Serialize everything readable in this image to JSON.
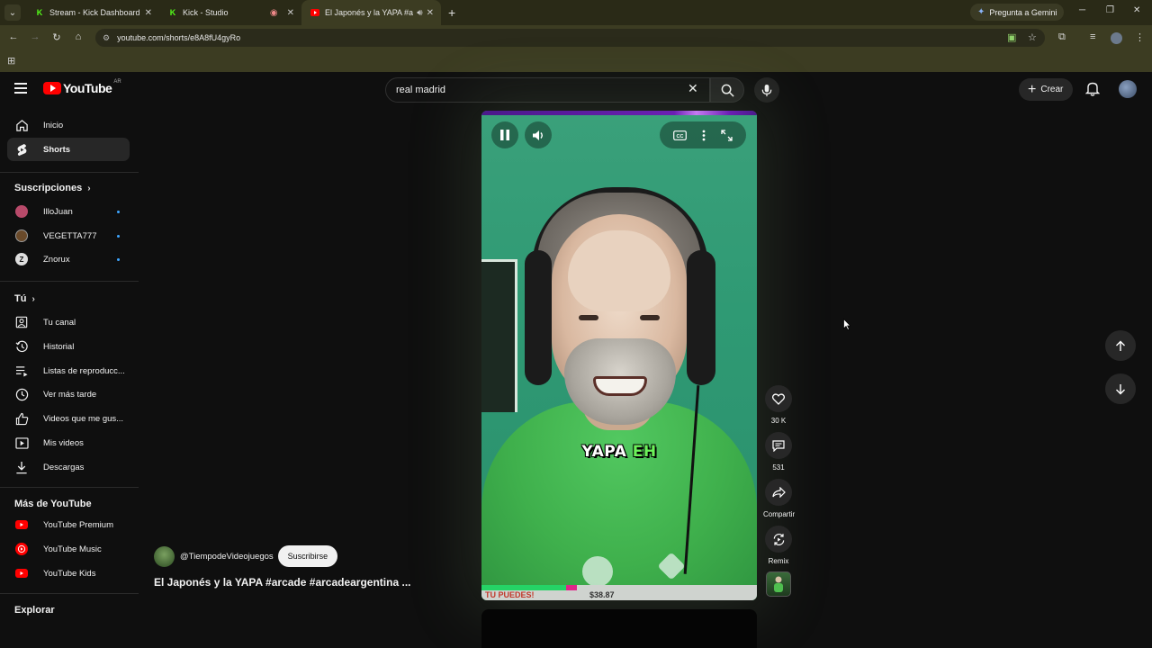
{
  "browser": {
    "tabs": [
      {
        "title": "Stream - Kick Dashboard",
        "fav": "K"
      },
      {
        "title": "Kick - Studio",
        "fav": "K"
      },
      {
        "title": "El Japonés y la YAPA #arcad",
        "fav": "yt"
      }
    ],
    "gemini_label": "Pregunta a Gemini",
    "url": "youtube.com/shorts/e8A8fU4gyRo"
  },
  "yt": {
    "logo_word": "YouTube",
    "region": "AR",
    "search_value": "real madrid",
    "create_label": "Crear"
  },
  "sidebar": {
    "main": [
      {
        "label": "Inicio",
        "icon": "home-icon"
      },
      {
        "label": "Shorts",
        "icon": "shorts-icon"
      }
    ],
    "subs_heading": "Suscripciones",
    "subs": [
      {
        "label": "IlloJuan",
        "color": "#b84a6a"
      },
      {
        "label": "VEGETTA777",
        "color": "#6a4a2a"
      },
      {
        "label": "Znorux",
        "color": "#dddddd"
      }
    ],
    "you_heading": "Tú",
    "you": [
      {
        "label": "Tu canal",
        "icon": "channel-icon"
      },
      {
        "label": "Historial",
        "icon": "history-icon"
      },
      {
        "label": "Listas de reproducc...",
        "icon": "playlists-icon"
      },
      {
        "label": "Ver más tarde",
        "icon": "watch-later-icon"
      },
      {
        "label": "Videos que me gus...",
        "icon": "like-icon"
      },
      {
        "label": "Mis videos",
        "icon": "my-videos-icon"
      },
      {
        "label": "Descargas",
        "icon": "download-icon"
      }
    ],
    "more_heading": "Más de YouTube",
    "more": [
      {
        "label": "YouTube Premium"
      },
      {
        "label": "YouTube Music"
      },
      {
        "label": "YouTube Kids"
      }
    ],
    "explore_heading": "Explorar"
  },
  "short": {
    "subtitle_word1": "YAPA",
    "subtitle_word2": "EH",
    "strip_text1": "TU PUEDES!",
    "strip_text2": "$38.87",
    "channel_handle": "@TiempodeVideojuegos",
    "subscribe_label": "Suscribirse",
    "title": "El Japonés y la YAPA #arcade #arcadeargentina ..."
  },
  "actions": {
    "likes": "30 K",
    "comments": "531",
    "share": "Compartir",
    "remix": "Remix"
  },
  "colors": {
    "yt_red": "#ff0000",
    "sub_dot": "#3ea6ff",
    "subtitle_accent": "#6cf25a"
  }
}
